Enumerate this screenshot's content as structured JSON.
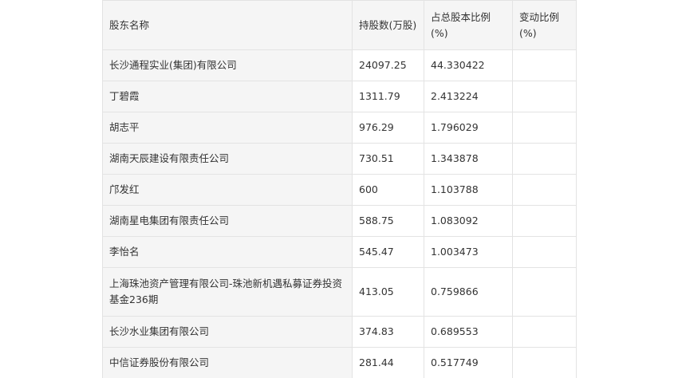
{
  "table": {
    "headers": [
      "股东名称",
      "持股数(万股)",
      "占总股本比例(%)",
      "变动比例(%)"
    ],
    "rows": [
      {
        "name": "长沙通程实业(集团)有限公司",
        "shares": "24097.25",
        "ratio": "44.330422",
        "change": ""
      },
      {
        "name": "丁碧霞",
        "shares": "1311.79",
        "ratio": "2.413224",
        "change": ""
      },
      {
        "name": "胡志平",
        "shares": "976.29",
        "ratio": "1.796029",
        "change": ""
      },
      {
        "name": "湖南天辰建设有限责任公司",
        "shares": "730.51",
        "ratio": "1.343878",
        "change": ""
      },
      {
        "name": "邝发红",
        "shares": "600",
        "ratio": "1.103788",
        "change": ""
      },
      {
        "name": "湖南星电集团有限责任公司",
        "shares": "588.75",
        "ratio": "1.083092",
        "change": ""
      },
      {
        "name": "李怡名",
        "shares": "545.47",
        "ratio": "1.003473",
        "change": ""
      },
      {
        "name": "上海珠池资产管理有限公司-珠池新机遇私募证券投资基金236期",
        "shares": "413.05",
        "ratio": "0.759866",
        "change": ""
      },
      {
        "name": "长沙水业集团有限公司",
        "shares": "374.83",
        "ratio": "0.689553",
        "change": ""
      },
      {
        "name": "中信证券股份有限公司",
        "shares": "281.44",
        "ratio": "0.517749",
        "change": ""
      }
    ]
  }
}
